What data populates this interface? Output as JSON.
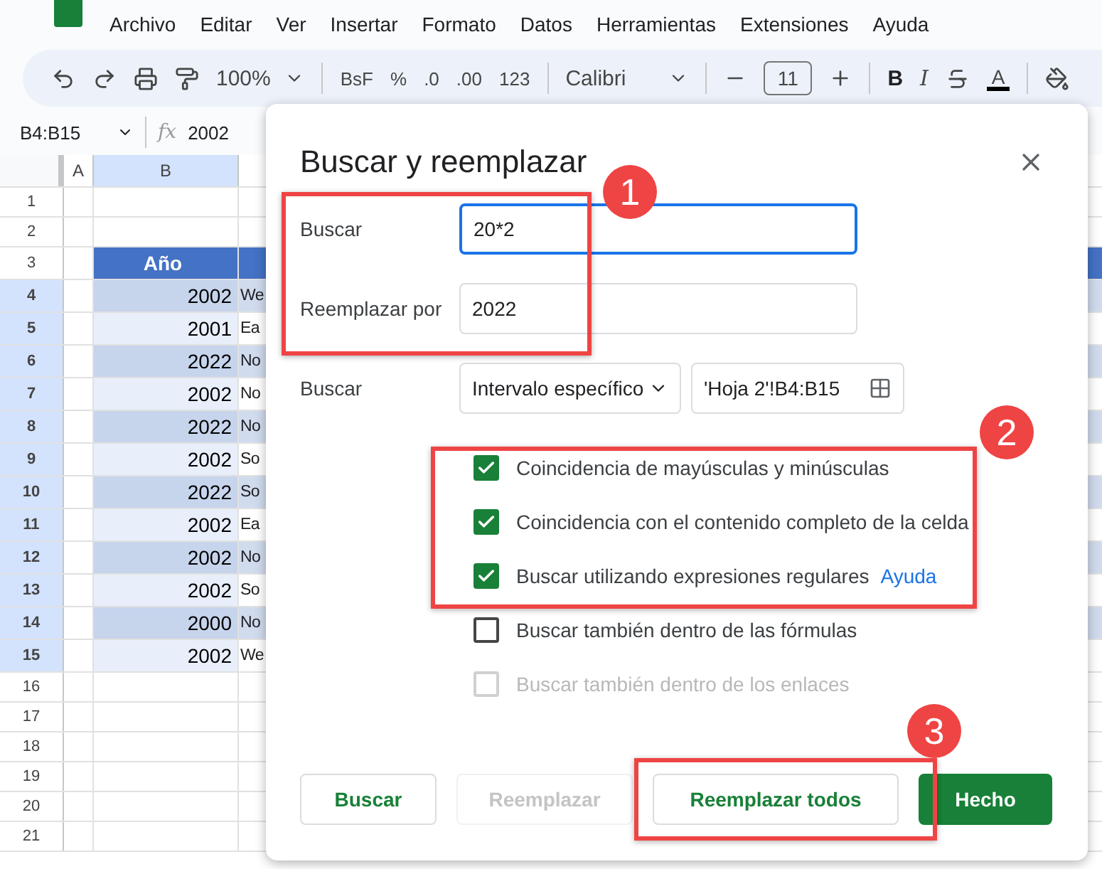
{
  "menu": [
    "Archivo",
    "Editar",
    "Ver",
    "Insertar",
    "Formato",
    "Datos",
    "Herramientas",
    "Extensiones",
    "Ayuda"
  ],
  "toolbar": {
    "zoom": "100%",
    "number_formats": [
      "BsF",
      "%",
      ".0",
      ".00",
      "123"
    ],
    "font": "Calibri",
    "font_size": "11",
    "bold": "B",
    "italic": "I",
    "text_color": "A"
  },
  "formula_bar": {
    "name_box": "B4:B15",
    "fx": "fx",
    "value": "2002"
  },
  "grid": {
    "columns": [
      {
        "label": "A",
        "selected": false
      },
      {
        "label": "B",
        "selected": true
      }
    ],
    "rows": [
      {
        "number": "1",
        "kind": "blank",
        "selected": false
      },
      {
        "number": "2",
        "kind": "blank",
        "selected": false
      },
      {
        "number": "3",
        "kind": "header",
        "selected": false,
        "b": "Año"
      },
      {
        "number": "4",
        "kind": "data",
        "selected": true,
        "b": "2002",
        "c": "We"
      },
      {
        "number": "5",
        "kind": "data",
        "selected": true,
        "b": "2001",
        "c": "Ea"
      },
      {
        "number": "6",
        "kind": "data",
        "selected": true,
        "b": "2022",
        "c": "No"
      },
      {
        "number": "7",
        "kind": "data",
        "selected": true,
        "b": "2002",
        "c": "No"
      },
      {
        "number": "8",
        "kind": "data",
        "selected": true,
        "b": "2022",
        "c": "No"
      },
      {
        "number": "9",
        "kind": "data",
        "selected": true,
        "b": "2002",
        "c": "So"
      },
      {
        "number": "10",
        "kind": "data",
        "selected": true,
        "b": "2022",
        "c": "So"
      },
      {
        "number": "11",
        "kind": "data",
        "selected": true,
        "b": "2002",
        "c": "Ea"
      },
      {
        "number": "12",
        "kind": "data",
        "selected": true,
        "b": "2002",
        "c": "No"
      },
      {
        "number": "13",
        "kind": "data",
        "selected": true,
        "b": "2002",
        "c": "So"
      },
      {
        "number": "14",
        "kind": "data",
        "selected": true,
        "b": "2000",
        "c": "No"
      },
      {
        "number": "15",
        "kind": "data",
        "selected": true,
        "b": "2002",
        "c": "We"
      },
      {
        "number": "16",
        "kind": "blank",
        "selected": false
      },
      {
        "number": "17",
        "kind": "blank",
        "selected": false
      },
      {
        "number": "18",
        "kind": "blank",
        "selected": false
      },
      {
        "number": "19",
        "kind": "blank",
        "selected": false
      },
      {
        "number": "20",
        "kind": "blank",
        "selected": false
      },
      {
        "number": "21",
        "kind": "blank",
        "selected": false
      }
    ]
  },
  "dialog": {
    "title": "Buscar y reemplazar",
    "find": {
      "label": "Buscar",
      "value": "20*2"
    },
    "replace": {
      "label": "Reemplazar por",
      "value": "2022"
    },
    "scope": {
      "label": "Buscar",
      "option": "Intervalo específico",
      "range": "'Hoja 2'!B4:B15"
    },
    "options": [
      {
        "label": "Coincidencia de mayúsculas y minúsculas",
        "checked": true,
        "disabled": false
      },
      {
        "label": "Coincidencia con el contenido completo de la celda",
        "checked": true,
        "disabled": false
      },
      {
        "label": "Buscar utilizando expresiones regulares",
        "checked": true,
        "disabled": false,
        "link": "Ayuda"
      },
      {
        "label": "Buscar también dentro de las fórmulas",
        "checked": false,
        "disabled": false
      },
      {
        "label": "Buscar también dentro de los enlaces",
        "checked": false,
        "disabled": true
      }
    ],
    "buttons": [
      {
        "label": "Buscar",
        "kind": "outline",
        "disabled": false
      },
      {
        "label": "Reemplazar",
        "kind": "outline",
        "disabled": true
      },
      {
        "label": "Reemplazar todos",
        "kind": "outline",
        "disabled": false
      },
      {
        "label": "Hecho",
        "kind": "primary",
        "disabled": false
      }
    ]
  },
  "annotations": [
    "1",
    "2",
    "3"
  ]
}
